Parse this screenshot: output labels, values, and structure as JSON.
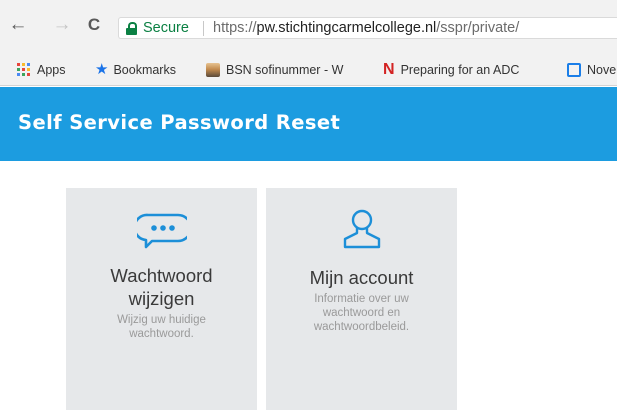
{
  "browser": {
    "nav": {
      "back_glyph": "←",
      "forward_glyph": "→",
      "reload_glyph": "C"
    },
    "address_bar": {
      "secure_label": "Secure",
      "url_scheme": "https://",
      "url_host": "pw.stichtingcarmelcollege.nl",
      "url_path": "/sspr/private/"
    },
    "bookmarks": [
      {
        "label": "Apps",
        "icon": "apps-grid-icon"
      },
      {
        "label": "Bookmarks",
        "icon": "star-icon"
      },
      {
        "label": "BSN sofinummer - W",
        "icon": "person-photo-icon"
      },
      {
        "label": "Preparing for an ADC",
        "icon": "n-logo-icon"
      },
      {
        "label": "Nove",
        "icon": "square-outline-icon"
      }
    ],
    "colors": {
      "secure_green": "#0b8043",
      "star_blue": "#1a73e8",
      "n_red": "#d32323"
    }
  },
  "page": {
    "banner": {
      "title": "Self Service Password Reset",
      "color": "#1c9ce0"
    },
    "tiles": [
      {
        "title_line1": "Wachtwoord",
        "title_line2": "wijzigen",
        "desc_line1": "Wijzig uw huidige",
        "desc_line2": "wachtwoord.",
        "icon": "password-dots-icon"
      },
      {
        "title_line1": "Mijn account",
        "desc_line1": "Informatie over uw",
        "desc_line2": "wachtwoord en",
        "desc_line3": "wachtwoordbeleid.",
        "icon": "user-outline-icon"
      }
    ],
    "icon_color": "#1c8fd8"
  }
}
